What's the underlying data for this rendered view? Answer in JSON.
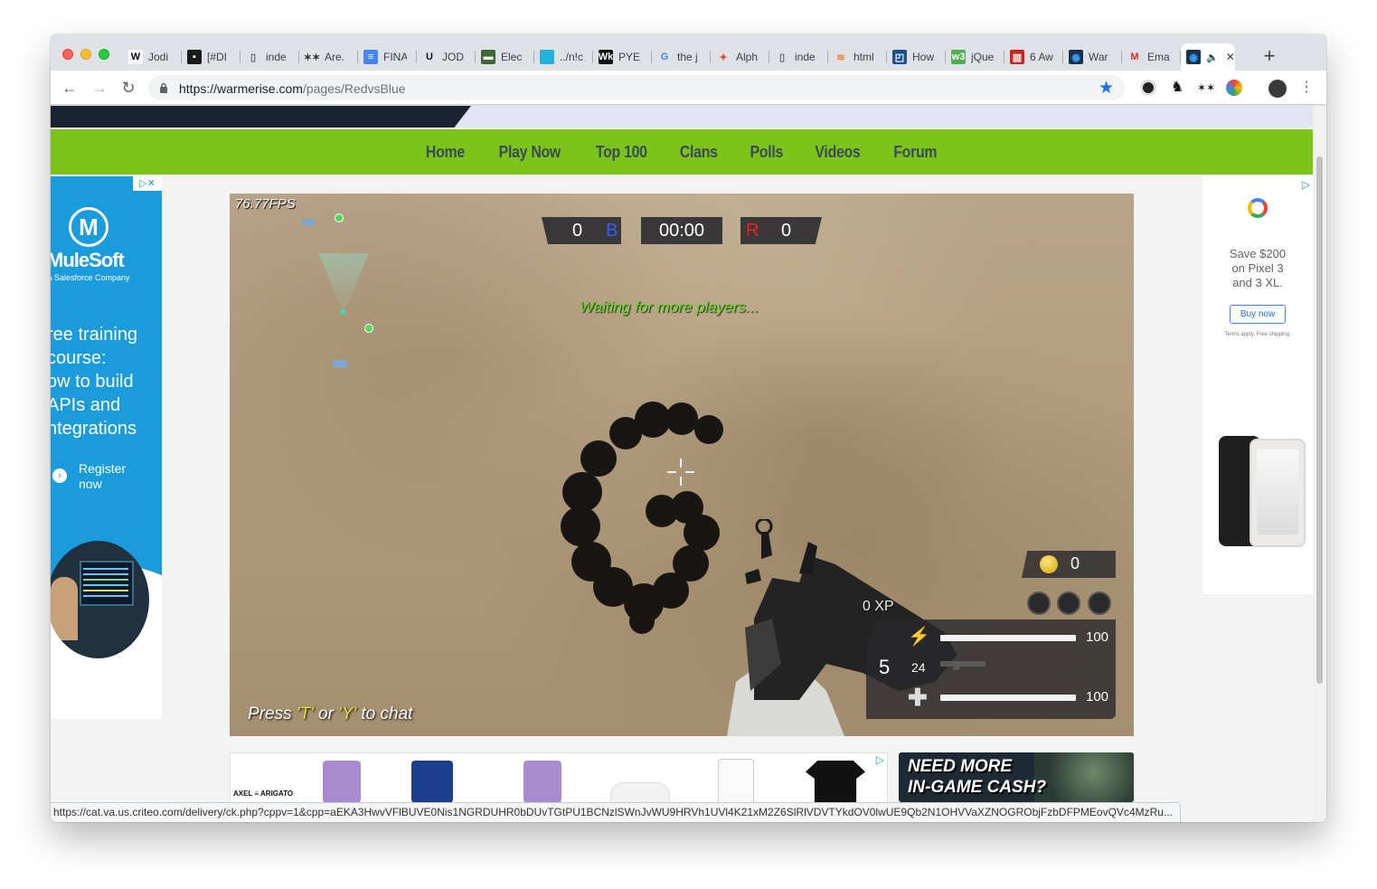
{
  "browser": {
    "tabs": [
      {
        "icon": "wikipedia-icon",
        "glyph": "W",
        "fav_bg": "#ffffff",
        "fav_fg": "#000000",
        "title": "Jodi"
      },
      {
        "icon": "slack-icon",
        "glyph": "▪",
        "fav_bg": "#1a1a1a",
        "fav_fg": "#ffffff",
        "title": "[#DI"
      },
      {
        "icon": "file-icon",
        "glyph": "▯",
        "fav_bg": "transparent",
        "fav_fg": "#5f6368",
        "title": "inde"
      },
      {
        "icon": "stars-icon",
        "glyph": "✶✶",
        "fav_bg": "transparent",
        "fav_fg": "#333333",
        "title": "Are."
      },
      {
        "icon": "google-docs-icon",
        "glyph": "≡",
        "fav_bg": "#4285f4",
        "fav_fg": "#ffffff",
        "title": "FINA"
      },
      {
        "icon": "u-logo-icon",
        "glyph": "U",
        "fav_bg": "transparent",
        "fav_fg": "#111111",
        "title": "JOD"
      },
      {
        "icon": "election-icon",
        "glyph": "▬",
        "fav_bg": "#3b6a34",
        "fav_fg": "#ffffff",
        "title": "Elec"
      },
      {
        "icon": "gradient-icon",
        "glyph": "",
        "fav_bg": "#21b3d9",
        "fav_fg": "#ffffff",
        "title": "../n!c"
      },
      {
        "icon": "wk-icon",
        "glyph": "Wk",
        "fav_bg": "#111111",
        "fav_fg": "#ffffff",
        "title": "PYE"
      },
      {
        "icon": "google-icon",
        "glyph": "G",
        "fav_bg": "transparent",
        "fav_fg": "#4285f4",
        "title": "the j"
      },
      {
        "icon": "alpha-icon",
        "glyph": "✦",
        "fav_bg": "transparent",
        "fav_fg": "#e0463a",
        "title": "Alph"
      },
      {
        "icon": "file-icon",
        "glyph": "▯",
        "fav_bg": "transparent",
        "fav_fg": "#5f6368",
        "title": "inde"
      },
      {
        "icon": "stackoverflow-icon",
        "glyph": "≋",
        "fav_bg": "transparent",
        "fav_fg": "#f48024",
        "title": "html"
      },
      {
        "icon": "howto-icon",
        "glyph": "◰",
        "fav_bg": "#1f4e8c",
        "fav_fg": "#ffffff",
        "title": "How"
      },
      {
        "icon": "w3schools-icon",
        "glyph": "w3",
        "fav_bg": "#4caf50",
        "fav_fg": "#ffffff",
        "title": "jQue"
      },
      {
        "icon": "red-book-icon",
        "glyph": "▥",
        "fav_bg": "#d02020",
        "fav_fg": "#ffffff",
        "title": "6 Aw"
      },
      {
        "icon": "warmerise-icon",
        "glyph": "◉",
        "fav_bg": "#17324a",
        "fav_fg": "#3aa0ff",
        "title": "War"
      },
      {
        "icon": "gmail-icon",
        "glyph": "M",
        "fav_bg": "transparent",
        "fav_fg": "#d93025",
        "title": "Ema"
      },
      {
        "icon": "warmerise-icon",
        "glyph": "◉",
        "fav_bg": "#17324a",
        "fav_fg": "#3aa0ff",
        "title": "",
        "active": true
      }
    ],
    "url_host": "https://warmerise.com",
    "url_path": "/pages/RedvsBlue",
    "status_url": "https://cat.va.us.criteo.com/delivery/ck.php?cppv=1&cpp=aEKA3HwvVFlBUVE0Nis1NGRDUHR0bDUvTGtPU1BCNzlSWnJvWU9HRVh1UVl4K21xM2Z6SlRlVDVTYkdOV0lwUE9Qb2N1OHVVaXZNOGRObjFzbDFPMEovQVc4MzRu..."
  },
  "site": {
    "nav": [
      "Home",
      "Play Now",
      "Top 100",
      "Clans",
      "Polls",
      "Videos",
      "Forum"
    ],
    "accent": "#7cc417"
  },
  "ads": {
    "left": {
      "brand": "MuleSoft",
      "brand_sub": "A Salesforce Company",
      "headline_lines": [
        "ree training",
        "course:",
        "ow to build",
        "APIs and",
        "ntegrations"
      ],
      "cta": [
        "Register",
        "now"
      ]
    },
    "right": {
      "logo": "G",
      "text_lines": [
        "Save $200",
        "on Pixel 3",
        "and 3 XL."
      ],
      "button": "Buy now",
      "fine": "Terms apply. Free shipping."
    },
    "bottom_left": {
      "brand": "AXEL ≡ ARIGATO"
    },
    "bottom_right": {
      "line1": "NEED MORE",
      "line2": "IN-GAME CASH?"
    }
  },
  "game": {
    "fps": "76.77FPS",
    "blue_score": "0",
    "blue_label": "B",
    "timer": "00:00",
    "red_label": "R",
    "red_score": "0",
    "status": "Waiting for more players...",
    "chat_prefix": "Press ",
    "chat_key1": "'T'",
    "chat_or": " or ",
    "chat_key2": "'Y'",
    "chat_suffix": " to chat",
    "coins": "0",
    "xp": "0 XP",
    "energy": "100",
    "energy_level": 1.0,
    "clip": "5",
    "reserve": "24",
    "health": "100",
    "health_level": 1.0
  }
}
